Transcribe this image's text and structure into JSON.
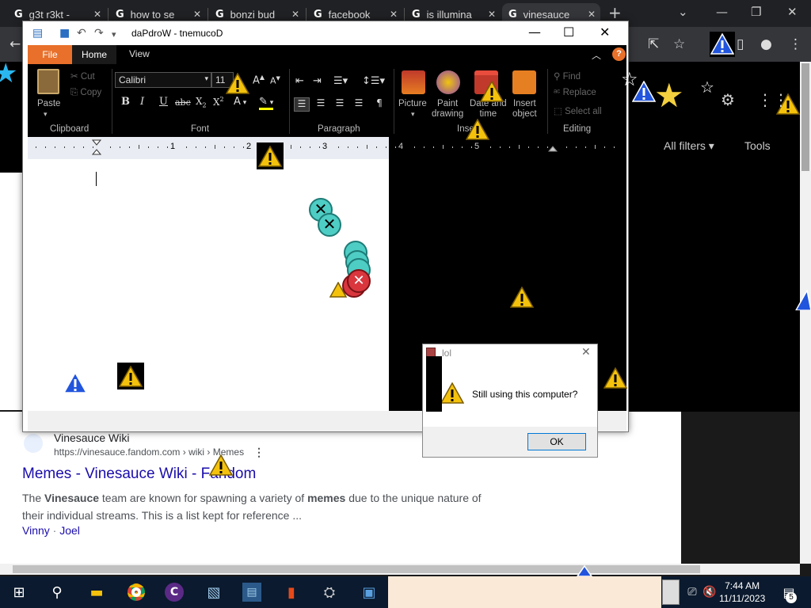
{
  "browser": {
    "tabs": [
      {
        "title": "g3t r3kt - "
      },
      {
        "title": "how to se"
      },
      {
        "title": "bonzi bud"
      },
      {
        "title": "facebook"
      },
      {
        "title": "is illumina"
      },
      {
        "title": "vinesauce"
      }
    ],
    "new_tab": "+"
  },
  "search": {
    "all_filters": "All filters",
    "tools": "Tools"
  },
  "result": {
    "site": "Vinesauce Wiki",
    "url": "https://vinesauce.fandom.com › wiki › Memes",
    "title": "Memes - Vinesauce Wiki - Fandom",
    "snippet_parts": [
      "The ",
      "Vinesauce",
      " team are known for spawning a variety of ",
      "memes",
      " due to the unique nature of their individual streams. This is a list kept for reference ..."
    ],
    "links": [
      "Vinny",
      "Joel"
    ],
    "link_sep": " · "
  },
  "wordpad": {
    "title": "daPdroW - tnemucoD",
    "tabs": {
      "file": "File",
      "home": "Home",
      "view": "View"
    },
    "clipboard": {
      "paste": "Paste",
      "cut": "Cut",
      "copy": "Copy",
      "label": "Clipboard"
    },
    "font": {
      "name": "Calibri",
      "size": "11",
      "label": "Font"
    },
    "paragraph": {
      "label": "Paragraph"
    },
    "insert": {
      "picture": "Picture",
      "paint": [
        "Paint",
        "drawing"
      ],
      "datetime": [
        "Date and",
        "time"
      ],
      "object": [
        "Insert",
        "object"
      ],
      "label": "Insert"
    },
    "editing": {
      "find": "Find",
      "replace": "Replace",
      "select_all": "Select all",
      "label": "Editing"
    },
    "ruler": [
      "1",
      "2",
      "3",
      "4",
      "5"
    ]
  },
  "dialog": {
    "title": "lol",
    "message": "Still using this computer?",
    "ok": "OK"
  },
  "taskbar": {
    "time": "7:44 AM",
    "date": "11/11/2023",
    "notif_count": "5"
  }
}
